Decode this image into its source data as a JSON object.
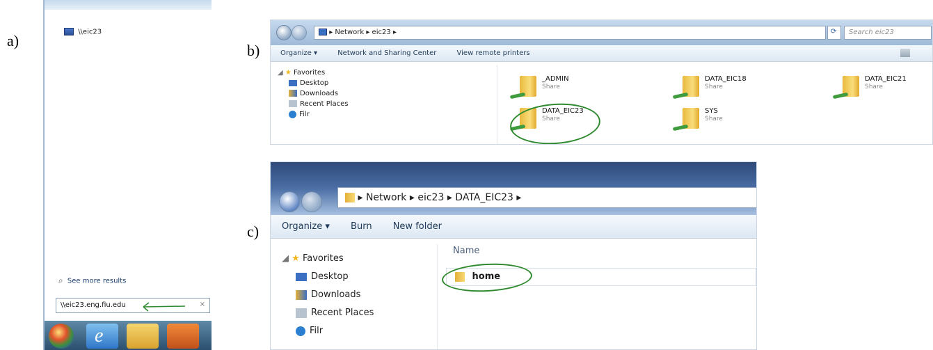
{
  "labels": {
    "a": "a)",
    "b": "b)",
    "c": "c)"
  },
  "panel_a": {
    "result_item": "\\\\eic23",
    "see_more": "See more results",
    "search_value": "\\\\eic23.eng.fiu.edu",
    "clear_glyph": "×",
    "taskbar_icons": [
      "start-orb-icon",
      "internet-explorer-icon",
      "file-explorer-icon",
      "media-player-icon"
    ]
  },
  "panel_b": {
    "address": [
      "Network",
      "eic23"
    ],
    "search_placeholder": "Search eic23",
    "toolbar": [
      "Organize ▾",
      "Network and Sharing Center",
      "View remote printers"
    ],
    "nav": [
      "Favorites",
      "Desktop",
      "Downloads",
      "Recent Places",
      "Filr"
    ],
    "shares": [
      {
        "name": "_ADMIN",
        "type": "Share"
      },
      {
        "name": "DATA_EIC18",
        "type": "Share"
      },
      {
        "name": "DATA_EIC21",
        "type": "Share"
      },
      {
        "name": "DATA_EIC23",
        "type": "Share"
      },
      {
        "name": "SYS",
        "type": "Share"
      }
    ]
  },
  "panel_c": {
    "address": [
      "Network",
      "eic23",
      "DATA_EIC23"
    ],
    "toolbar": [
      "Organize ▾",
      "Burn",
      "New folder"
    ],
    "nav": [
      "Favorites",
      "Desktop",
      "Downloads",
      "Recent Places",
      "Filr"
    ],
    "column_header": "Name",
    "items": [
      "home"
    ]
  },
  "colors": {
    "annotation": "#2f8a2f",
    "folder": "#f0c44c",
    "window_frame": "#9fbad8"
  }
}
